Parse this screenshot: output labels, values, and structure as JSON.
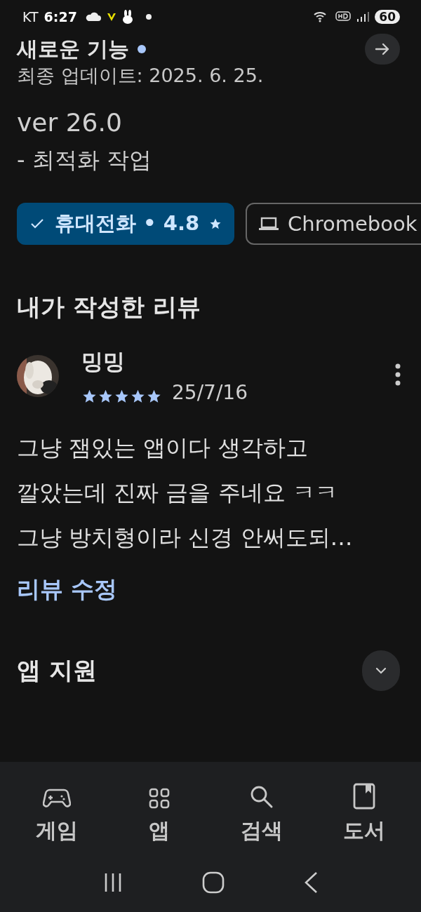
{
  "status_bar": {
    "carrier": "KT",
    "time": "6:27",
    "battery": "60"
  },
  "whats_new": {
    "title": "새로운 기능",
    "updated": "최종 업데이트: 2025. 6. 25.",
    "version": "ver 26.0",
    "notes": "- 최적화 작업"
  },
  "device_chips": [
    {
      "kind": "phone",
      "label": "휴대전화 • 4.8",
      "selected": true
    },
    {
      "kind": "laptop",
      "label": "Chromebook",
      "selected": false
    }
  ],
  "my_review": {
    "heading": "내가 작성한 리뷰",
    "author": "밍밍",
    "stars": 5,
    "date": "25/7/16",
    "text": "그냥 잼있는 앱이다 생각하고 깔았는데 진짜 금을 주네요 ㅋㅋ 그냥 방치형이라 신경 안써도되…",
    "edit_link": "리뷰 수정"
  },
  "app_support": {
    "title": "앱 지원",
    "expanded": false
  },
  "bottom_nav": [
    {
      "kind": "games",
      "label": "게임",
      "selected": false
    },
    {
      "kind": "apps",
      "label": "앱",
      "selected": false
    },
    {
      "kind": "search",
      "label": "검색",
      "selected": false
    },
    {
      "kind": "books",
      "label": "도서",
      "selected": false
    }
  ]
}
